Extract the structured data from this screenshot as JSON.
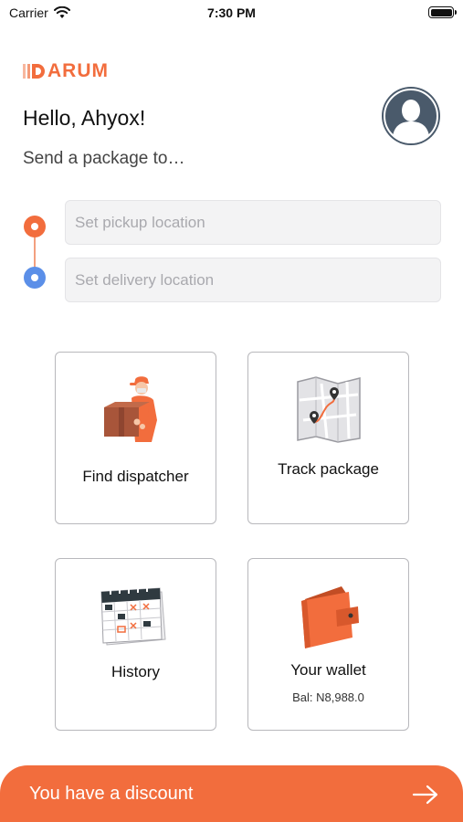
{
  "status_bar": {
    "carrier": "Carrier",
    "time": "7:30 PM"
  },
  "brand": {
    "name": "ARUM",
    "accent_color": "#f26d3d"
  },
  "header": {
    "greeting": "Hello, Ahyox!",
    "subtitle": "Send a package to…"
  },
  "locations": {
    "pickup_placeholder": "Set pickup location",
    "delivery_placeholder": "Set delivery location",
    "pickup_dot_color": "#f26d3d",
    "delivery_dot_color": "#5b8fe8"
  },
  "cards": {
    "find": {
      "label": "Find dispatcher",
      "icon": "dispatcher-icon"
    },
    "track": {
      "label": "Track package",
      "icon": "map-icon"
    },
    "history": {
      "label": "History",
      "icon": "calendar-icon"
    },
    "wallet": {
      "label": "Your wallet",
      "balance": "Bal: N8,988.0",
      "icon": "wallet-icon"
    }
  },
  "discount": {
    "label": "You have a discount",
    "icon": "arrow-right-icon"
  }
}
